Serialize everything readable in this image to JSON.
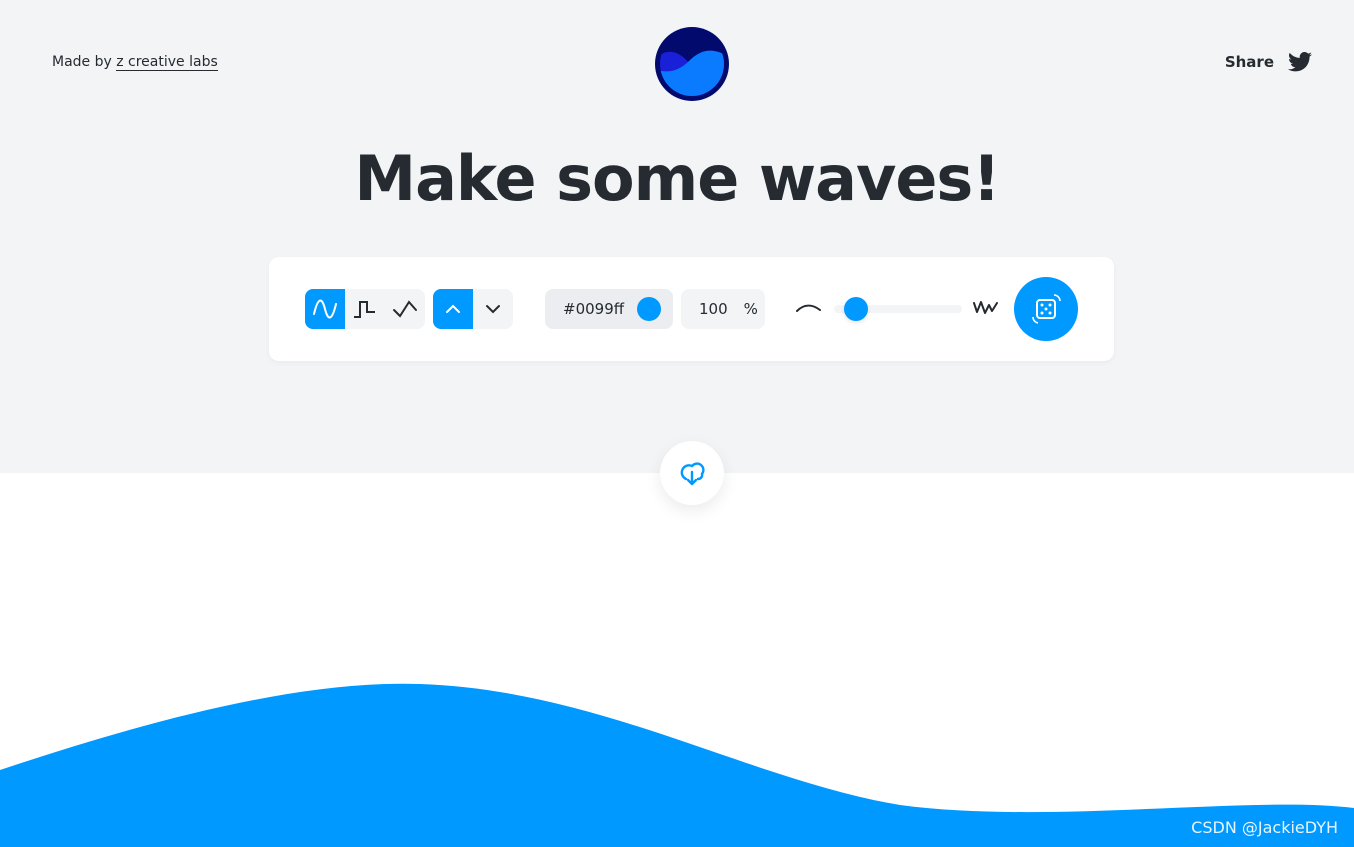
{
  "header": {
    "made_by": "Made by",
    "made_by_link": "z creative labs",
    "share": "Share"
  },
  "title": "Make some waves!",
  "controls": {
    "wave_types": [
      {
        "name": "smooth",
        "active": true
      },
      {
        "name": "step",
        "active": false
      },
      {
        "name": "peak",
        "active": false
      }
    ],
    "direction": [
      {
        "name": "up",
        "active": true
      },
      {
        "name": "down",
        "active": false
      }
    ],
    "color": "#0099ff",
    "opacity": "100",
    "opacity_unit": "%",
    "complexity_percent": 17
  },
  "colors": {
    "accent": "#0099ff",
    "background": "#f3f4f6",
    "text": "#252b31"
  },
  "watermark": "CSDN @JackieDYH"
}
